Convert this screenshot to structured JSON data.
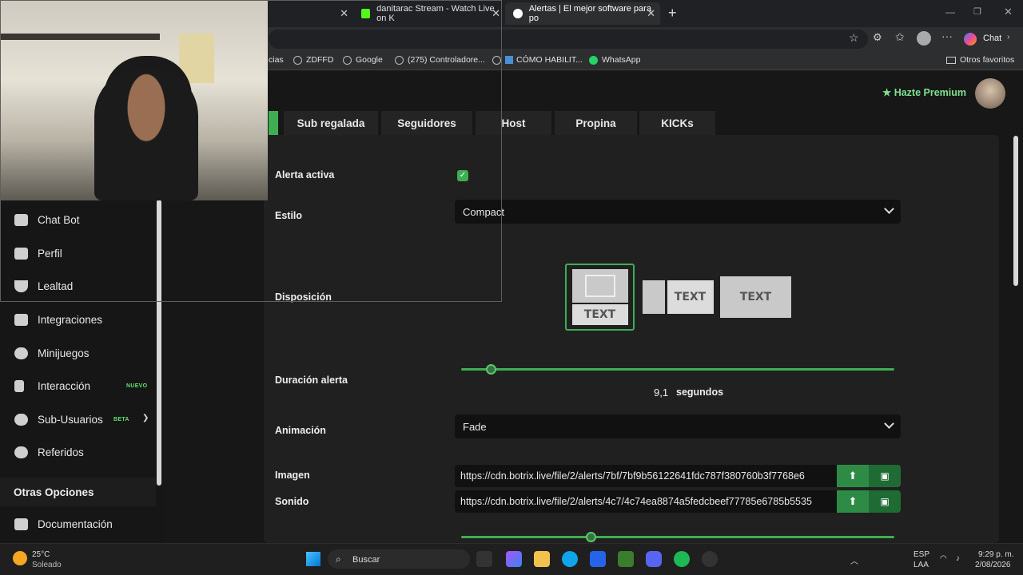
{
  "browser": {
    "tabs": [
      {
        "label": ""
      },
      {
        "label": "danitarac Stream - Watch Live on K"
      },
      {
        "label": "Alertas | El mejor software para po"
      }
    ],
    "bookmarks": [
      "cias",
      "ZDFFD",
      "Google",
      "(275) Controladore...",
      "CÓMO HABILIT...",
      "WhatsApp"
    ],
    "other_favorites": "Otros favoritos",
    "chat_label": "Chat"
  },
  "header": {
    "premium_label": "Hazte Premium"
  },
  "category_tabs": [
    "Sub regalada",
    "Seguidores",
    "Host",
    "Propina",
    "KICKs"
  ],
  "sidebar": {
    "items": [
      {
        "label": "Chat Bot"
      },
      {
        "label": "Perfil"
      },
      {
        "label": "Lealtad"
      },
      {
        "label": "Integraciones"
      },
      {
        "label": "Minijuegos"
      },
      {
        "label": "Interacción",
        "badge": "NUEVO"
      },
      {
        "label": "Sub-Usuarios",
        "badge": "BETA"
      },
      {
        "label": "Referidos"
      }
    ],
    "section_title": "Otras Opciones",
    "doc_item": "Documentación"
  },
  "form": {
    "active_label": "Alerta activa",
    "active_checked": true,
    "style_label": "Estilo",
    "style_value": "Compact",
    "layout_label": "Disposición",
    "layout_text": "TEXT",
    "duration_label": "Duración alerta",
    "duration_value": "9,1",
    "duration_unit": "segundos",
    "duration_fraction": 0.07,
    "animation_label": "Animación",
    "animation_value": "Fade",
    "image_label": "Imagen",
    "image_url": "https://cdn.botrix.live/file/2/alerts/7bf/7bf9b56122641fdc787f380760b3f7768e6",
    "sound_label": "Sonido",
    "sound_url": "https://cdn.botrix.live/file/2/alerts/4c7/4c74ea8874a5fedcbeef77785e6785b5535",
    "volume_fraction": 0.3
  },
  "taskbar": {
    "weather_temp": "25°C",
    "weather_desc": "Soleado",
    "search_placeholder": "Buscar",
    "lang_top": "ESP",
    "lang_bottom": "LAA",
    "time": "9:29 p. m.",
    "date": "2/08/2026"
  },
  "colors": {
    "accent": "#3fae52",
    "premium": "#7ee08f",
    "background": "#171717"
  }
}
